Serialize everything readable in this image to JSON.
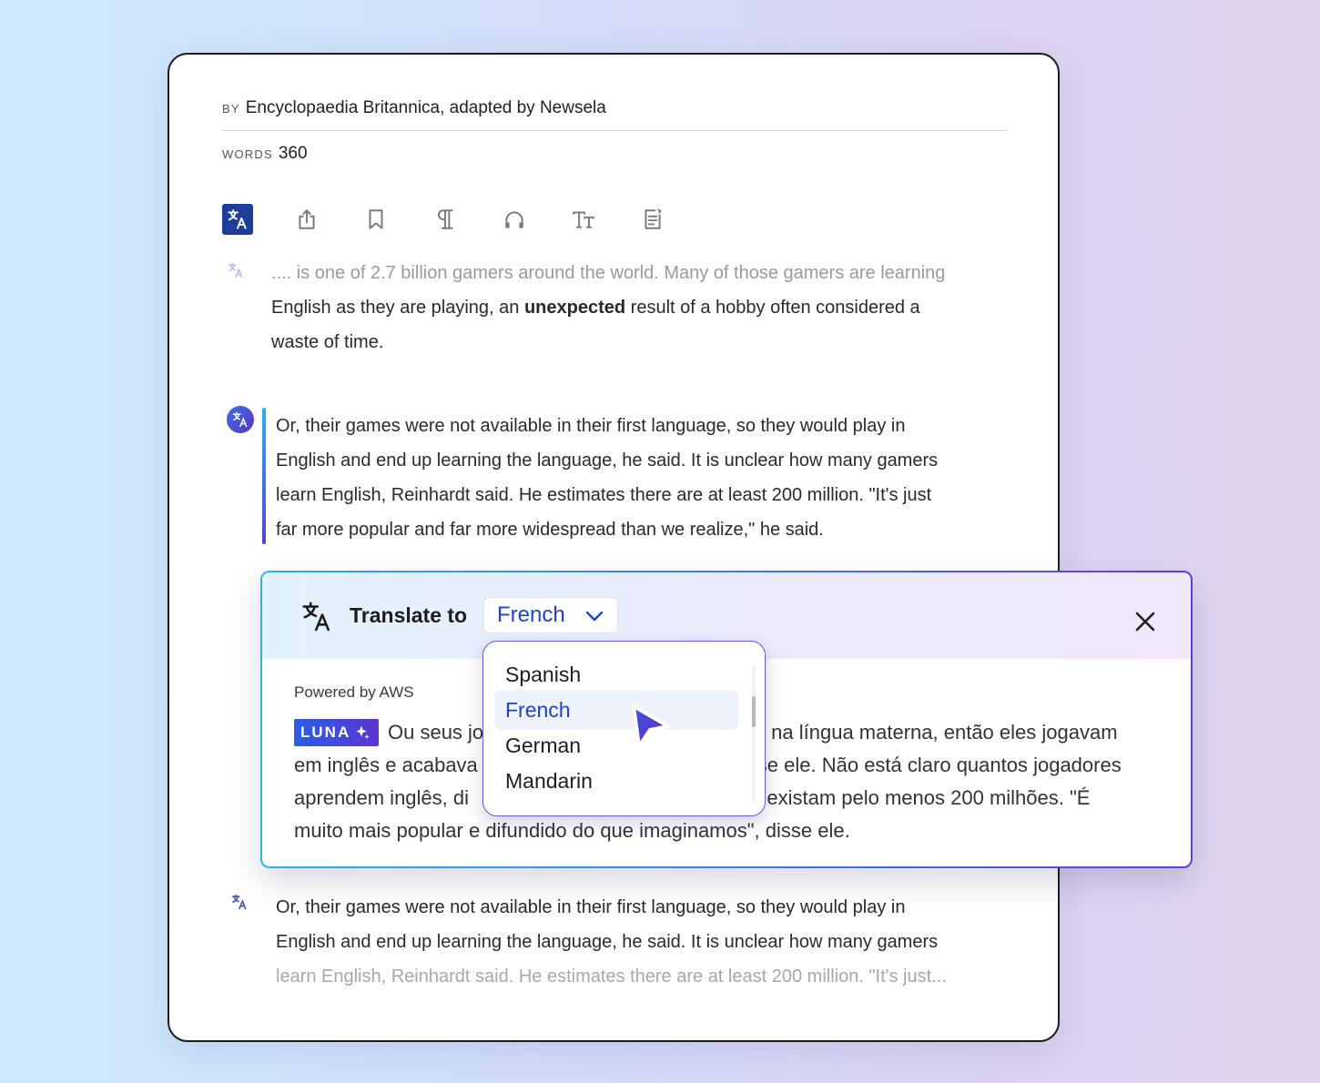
{
  "meta": {
    "by_label": "BY",
    "by_value": "Encyclopaedia Britannica, adapted by Newsela",
    "words_label": "WORDS",
    "words_value": "360"
  },
  "toolbar": {
    "icons": [
      "translate-icon",
      "share-icon",
      "bookmark-icon",
      "paragraph-icon",
      "headphones-icon",
      "text-size-icon",
      "notes-icon"
    ],
    "active_color": "#1f3e9c"
  },
  "article": {
    "para1": {
      "line1": ".... is one of 2.7 billion gamers around the world. Many of those gamers are learning",
      "line2a": "English as they are playing, an ",
      "line2b": "unexpected",
      "line2c": " result of a hobby often considered a",
      "line3": "waste of time."
    },
    "para2": {
      "line1": "Or, their games were not available in their first language, so they would play in",
      "line2": "English and end up learning the language, he said. It is unclear how many gamers",
      "line3": "learn English, Reinhardt said. He estimates there are at least 200 million. \"It's just",
      "line4": "far more popular and far more widespread than we realize,\" he said."
    },
    "para3": {
      "line1": "Or, their games were not available in their first language, so they would play in",
      "line2": "English and end up learning the language, he said. It is unclear how many gamers",
      "line3": "learn English, Reinhardt said. He estimates there are at least 200 million. \"It's just..."
    }
  },
  "translate_panel": {
    "title": "Translate to",
    "selected_language": "French",
    "powered_by": "Powered by AWS",
    "badge": "LUNA",
    "translated": {
      "line1a": "Ou seus jo",
      "line1b": "na língua materna, então eles jogavam",
      "line2a": "em inglês e acabava",
      "line2b": "se ele. Não está claro quantos jogadores",
      "line3a": "aprendem inglês, di",
      "line3b": "e existam pelo menos 200 milhões. \"É",
      "line4": "muito mais popular e difundido do que imaginamos\", disse ele."
    },
    "accent_start": "#27b5ec",
    "accent_end": "#5b3fd4"
  },
  "dropdown": {
    "options": [
      "Spanish",
      "French",
      "German",
      "Mandarin"
    ],
    "selected_index": 1,
    "selected_color": "#2144c4"
  }
}
